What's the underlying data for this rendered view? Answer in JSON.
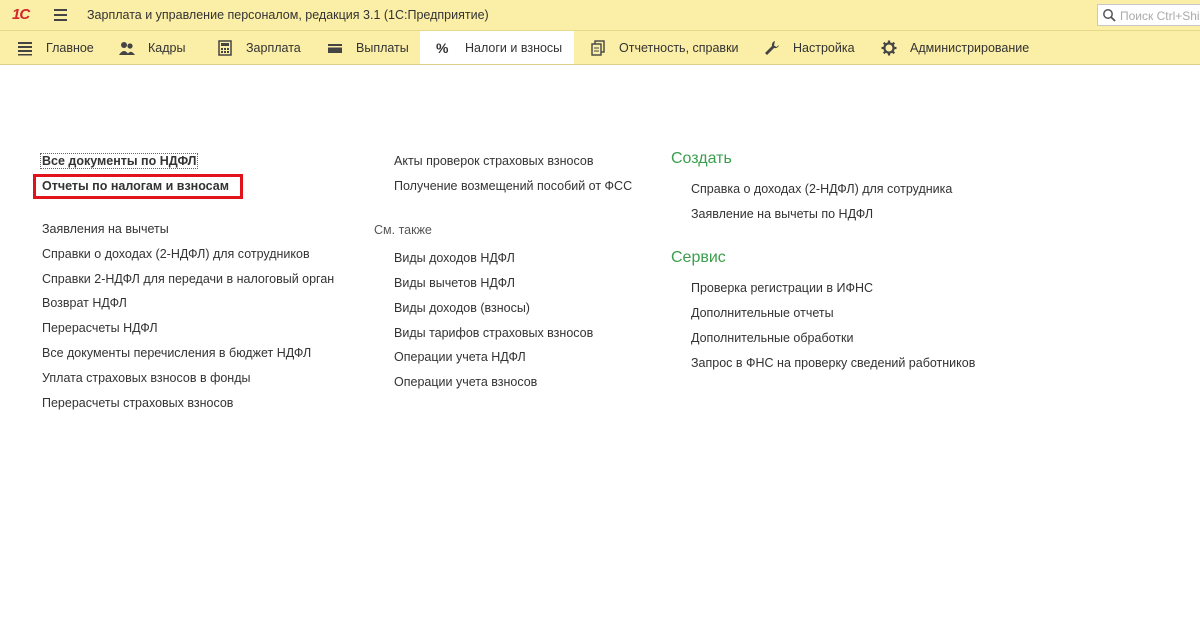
{
  "window": {
    "logo": "1С",
    "title": "Зарплата и управление персоналом, редакция 3.1  (1С:Предприятие)",
    "search_placeholder": "Поиск Ctrl+Shift+F"
  },
  "sections": [
    {
      "label": "Главное",
      "icon": "menu-lines-icon"
    },
    {
      "label": "Кадры",
      "icon": "people-icon"
    },
    {
      "label": "Зарплата",
      "icon": "calculator-icon"
    },
    {
      "label": "Выплаты",
      "icon": "wallet-icon"
    },
    {
      "label": "Налоги и взносы",
      "icon": "percent-icon",
      "active": true
    },
    {
      "label": "Отчетность, справки",
      "icon": "documents-icon"
    },
    {
      "label": "Настройка",
      "icon": "wrench-icon"
    },
    {
      "label": "Администрирование",
      "icon": "gear-icon"
    }
  ],
  "column1": {
    "top": [
      "Все документы по НДФЛ",
      "Отчеты по налогам и взносам"
    ],
    "items": [
      "Заявления на вычеты",
      "Справки о доходах (2-НДФЛ) для сотрудников",
      "Справки 2-НДФЛ для передачи в налоговый орган",
      "Возврат НДФЛ",
      "Перерасчеты НДФЛ",
      "Все документы перечисления в бюджет НДФЛ",
      "Уплата страховых взносов в фонды",
      "Перерасчеты страховых взносов"
    ]
  },
  "column2": {
    "items": [
      "Акты проверок страховых взносов",
      "Получение возмещений пособий от ФСС"
    ],
    "see_also_label": "См. также",
    "see_also": [
      "Виды доходов НДФЛ",
      "Виды вычетов НДФЛ",
      "Виды доходов (взносы)",
      "Виды тарифов страховых взносов",
      "Операции учета НДФЛ",
      "Операции учета взносов"
    ]
  },
  "column3": {
    "create_title": "Создать",
    "create": [
      "Справка о доходах (2-НДФЛ) для сотрудника",
      "Заявление на вычеты по НДФЛ"
    ],
    "service_title": "Сервис",
    "service": [
      "Проверка регистрации в ИФНС",
      "Дополнительные отчеты",
      "Дополнительные обработки",
      "Запрос в ФНС на проверку сведений работников"
    ]
  },
  "colors": {
    "panel": "#fbeea6",
    "group_title": "#3a9e4c",
    "highlight": "#e0131a"
  }
}
